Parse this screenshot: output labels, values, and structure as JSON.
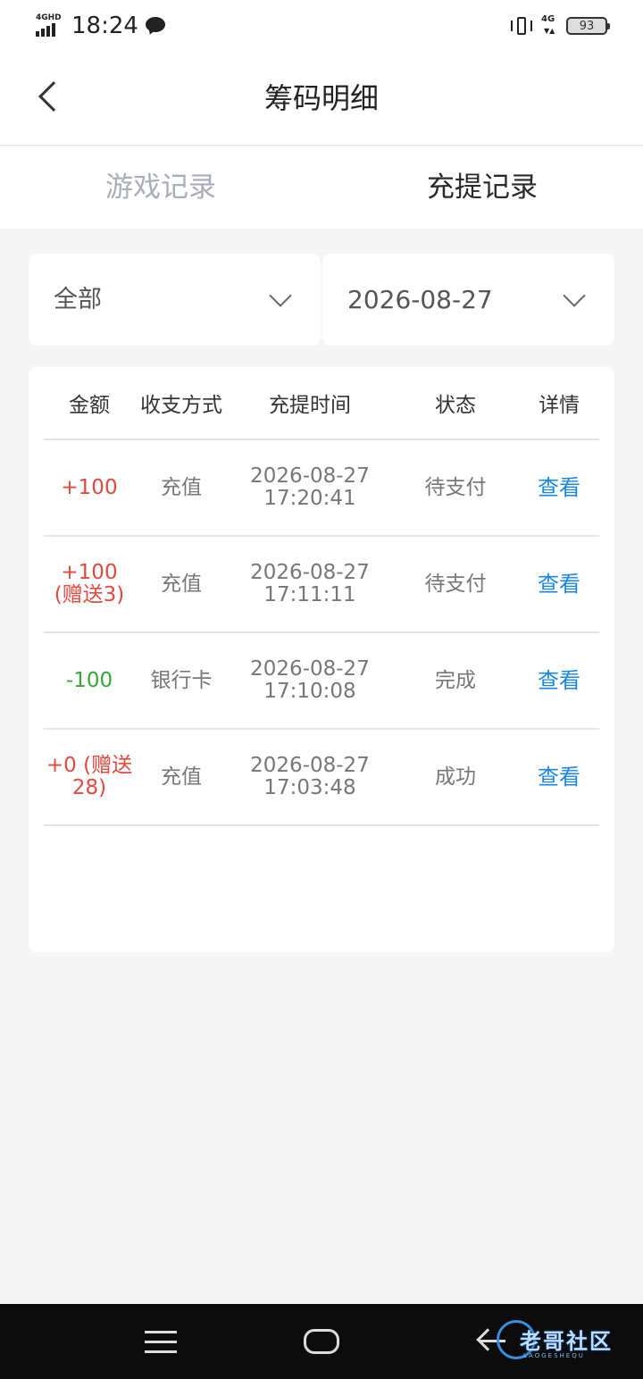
{
  "status_bar": {
    "network_type": "4GHD",
    "time": "18:24",
    "data_net": "4G",
    "battery": "93",
    "icons": [
      "signal-icon",
      "chat-icon",
      "vibrate-icon",
      "battery-icon"
    ]
  },
  "header": {
    "title": "筹码明细",
    "back_icon": "chevron-left-icon"
  },
  "tabs": [
    {
      "label": "游戏记录",
      "active": false
    },
    {
      "label": "充提记录",
      "active": true
    }
  ],
  "filters": {
    "type": "全部",
    "date": "2026-08-27"
  },
  "table": {
    "columns": [
      "金额",
      "收支方式",
      "充提时间",
      "状态",
      "详情"
    ],
    "rows": [
      {
        "amount": "+100",
        "method": "充值",
        "date": "2026-08-27",
        "time": "17:20:41",
        "status": "待支付",
        "action": "查看",
        "type": "positive"
      },
      {
        "amount": "+100\n(赠送3)",
        "method": "充值",
        "date": "2026-08-27",
        "time": "17:11:11",
        "status": "待支付",
        "action": "查看",
        "type": "positive"
      },
      {
        "amount": "-100",
        "method": "银行卡",
        "date": "2026-08-27",
        "time": "17:10:08",
        "status": "完成",
        "action": "查看",
        "type": "negative"
      },
      {
        "amount": "+0 (赠送\n28)",
        "method": "充值",
        "date": "2026-08-27",
        "time": "17:03:48",
        "status": "成功",
        "action": "查看",
        "type": "positive"
      }
    ]
  },
  "system_nav": {
    "icons": [
      "menu-icon",
      "home-icon",
      "back-icon"
    ]
  },
  "watermark": {
    "brand": "老哥社区",
    "sub": "LAOGESHEQU"
  },
  "colors": {
    "positive": "#e04a3f",
    "negative": "#3aa33a",
    "link": "#1a86e6"
  }
}
